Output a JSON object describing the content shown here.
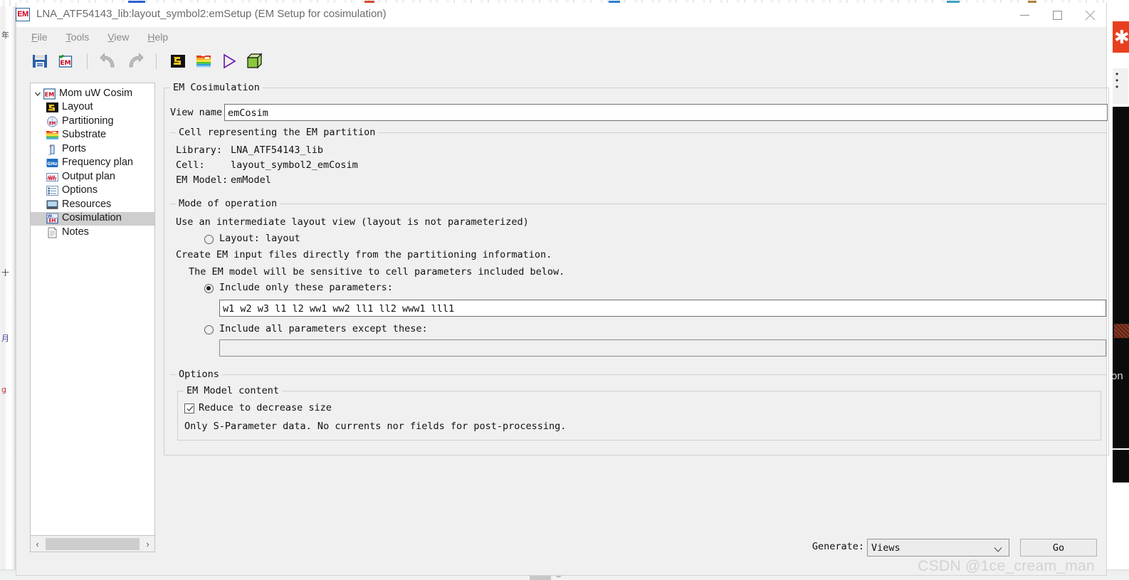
{
  "window": {
    "title": "LNA_ATF54143_lib:layout_symbol2:emSetup (EM Setup for cosimulation)",
    "app_icon_text": "EM",
    "minimize_label": "—",
    "maximize_label": "□",
    "close_label": "✕"
  },
  "menubar": {
    "items": [
      {
        "accel": "F",
        "rest": "ile"
      },
      {
        "accel": "T",
        "rest": "ools"
      },
      {
        "accel": "V",
        "rest": "iew"
      },
      {
        "accel": "H",
        "rest": "elp"
      }
    ]
  },
  "toolbar": {
    "buttons": [
      {
        "name": "save-icon",
        "title": "Save"
      },
      {
        "name": "save-em-setup-icon",
        "title": "Save EM Setup"
      },
      {
        "name": "undo-icon",
        "title": "Undo"
      },
      {
        "name": "redo-icon",
        "title": "Redo"
      },
      {
        "name": "layout-icon",
        "title": "Layout"
      },
      {
        "name": "substrate-icon",
        "title": "Substrate"
      },
      {
        "name": "simulate-icon",
        "title": "Simulate"
      },
      {
        "name": "3d-view-icon",
        "title": "3D EM Preview"
      }
    ]
  },
  "sidebar": {
    "root": {
      "label": "Mom uW Cosim",
      "icon": "em-icon",
      "expanded": true
    },
    "items": [
      {
        "label": "Layout",
        "icon": "layout-icon",
        "selected": false
      },
      {
        "label": "Partitioning",
        "icon": "partitioning-icon",
        "selected": false
      },
      {
        "label": "Substrate",
        "icon": "substrate-icon",
        "selected": false
      },
      {
        "label": "Ports",
        "icon": "ports-icon",
        "selected": false
      },
      {
        "label": "Frequency plan",
        "icon": "ghz-icon",
        "selected": false
      },
      {
        "label": "Output plan",
        "icon": "output-plan-icon",
        "selected": false
      },
      {
        "label": "Options",
        "icon": "options-icon",
        "selected": false
      },
      {
        "label": "Resources",
        "icon": "resources-icon",
        "selected": false
      },
      {
        "label": "Cosimulation",
        "icon": "cosimulation-icon",
        "selected": true
      },
      {
        "label": "Notes",
        "icon": "notes-icon",
        "selected": false
      }
    ],
    "scrollbar": {
      "left_arrow": "‹",
      "right_arrow": "›"
    }
  },
  "panel": {
    "em_cosim_group": {
      "title": "EM Cosimulation",
      "view_name_label": "View name",
      "view_name_value": "emCosim",
      "view_name_placeholder": "View name"
    },
    "cell_group": {
      "title": "Cell representing the EM partition",
      "library_label": "Library:",
      "library_value": "LNA_ATF54143_lib",
      "cell_label": "Cell:",
      "cell_value": "layout_symbol2_emCosim",
      "em_model_label": "EM Model:",
      "em_model_value": "emModel"
    },
    "mode_group": {
      "title": "Mode of operation",
      "intermediate_text": "Use an intermediate layout view (layout is not parameterized)",
      "layout_radio_label": "Layout: layout",
      "layout_radio_selected": false,
      "direct_text": "Create EM input files directly from the partitioning information.",
      "sensitive_text": "The EM model will be sensitive to cell parameters included below.",
      "include_only_label": "Include only these parameters:",
      "include_only_selected": true,
      "include_only_value": "w1 w2 w3 l1 l2 ww1 ww2 ll1 ll2 www1 lll1",
      "include_only_placeholder": "",
      "include_except_label": "Include all parameters except these:",
      "include_except_selected": false,
      "include_except_value": "",
      "include_except_placeholder": ""
    },
    "options_group": {
      "title": "Options",
      "em_model_content_title": "EM Model content",
      "reduce_label": "Reduce to decrease size",
      "reduce_checked": true,
      "reduce_note": "Only S-Parameter data. No currents nor fields for post-processing."
    }
  },
  "bottom": {
    "generate_label": "Generate:",
    "generate_value": "Views",
    "generate_options": [
      "Views"
    ],
    "go_label": "Go"
  },
  "watermark": {
    "text": "CSDN @1ce_cream_man"
  },
  "colors": {
    "window_bg": "#f0f0f0",
    "titlebar_bg": "#ffffff",
    "title_text": "#6b6b6b",
    "selection": "#cecece",
    "field_border": "#707070",
    "group_border": "#cfcfcf",
    "accent_blue": "#2a6099",
    "accent_red": "#d0021b"
  }
}
